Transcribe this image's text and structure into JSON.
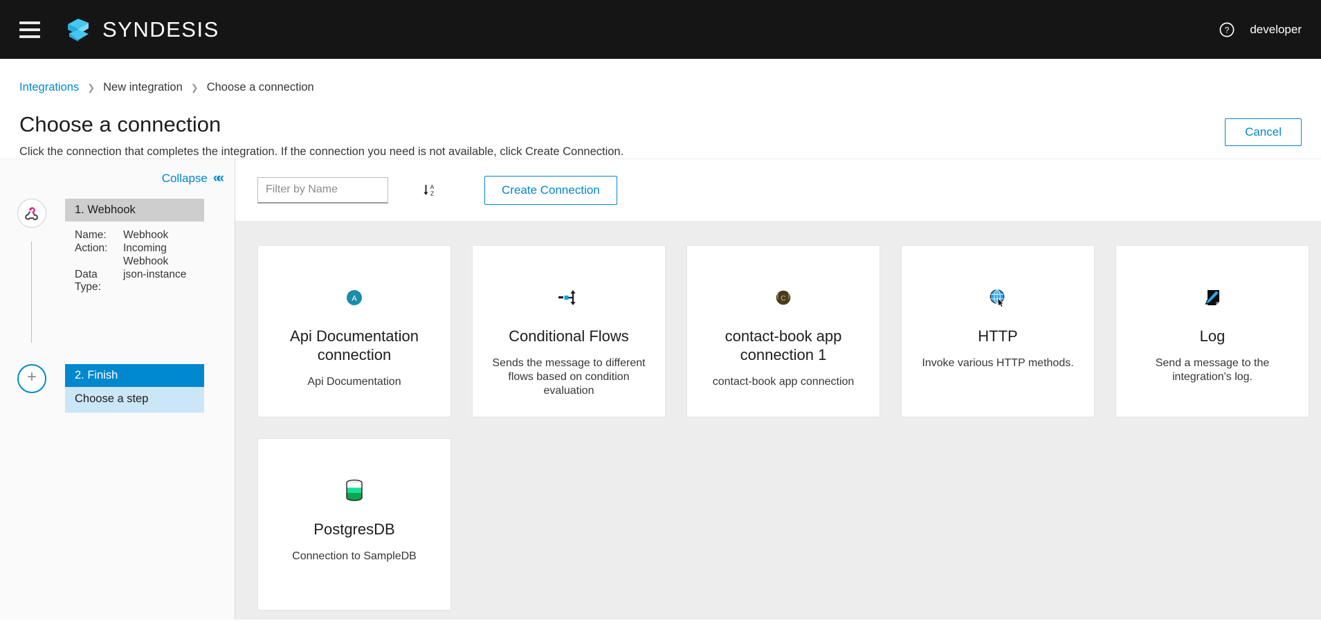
{
  "topbar": {
    "menu_icon": "hamburger-icon",
    "brand": "SYNDESIS",
    "help_icon": "help-circle-icon",
    "username": "developer"
  },
  "breadcrumb": {
    "items": [
      {
        "label": "Integrations",
        "link": true
      },
      {
        "label": "New integration",
        "link": false
      },
      {
        "label": "Choose a connection",
        "link": false
      }
    ],
    "separator": "❯"
  },
  "page": {
    "title": "Choose a connection",
    "description": "Click the connection that completes the integration. If the connection you need is not available, click Create Connection.",
    "cancel_label": "Cancel"
  },
  "sidebar": {
    "collapse_label": "Collapse",
    "collapse_icon": "double-chevron-left-icon",
    "steps": [
      {
        "header": "1. Webhook",
        "icon": "webhook-icon",
        "active": false,
        "details": [
          {
            "key": "Name:",
            "value": "Webhook"
          },
          {
            "key": "Action:",
            "value": "Incoming Webhook"
          },
          {
            "key": "Data Type:",
            "value": "json-instance"
          }
        ]
      },
      {
        "header": "2. Finish",
        "icon": "plus-icon",
        "active": true,
        "sub": "Choose a step"
      }
    ]
  },
  "toolbar": {
    "filter_placeholder": "Filter by Name",
    "filter_value": "",
    "sort_icon": "sort-alpha-down-icon",
    "create_label": "Create Connection"
  },
  "connections": [
    {
      "title": "Api Documentation connection",
      "description": "Api Documentation",
      "icon": "api-documentation-icon",
      "icon_color": "#1b8cab"
    },
    {
      "title": "Conditional Flows",
      "description": "Sends the message to different flows based on condition evaluation",
      "icon": "conditional-flows-icon",
      "icon_color": "#0aa3e8"
    },
    {
      "title": "contact-book app connection 1",
      "description": "contact-book app connection",
      "icon": "contact-book-icon",
      "icon_color": "#4a3b1a"
    },
    {
      "title": "HTTP",
      "description": "Invoke various HTTP methods.",
      "icon": "http-globe-icon",
      "icon_color": "#27a3e8"
    },
    {
      "title": "Log",
      "description": "Send a message to the integration's log.",
      "icon": "log-pen-icon",
      "icon_color": "#29a8e8"
    },
    {
      "title": "PostgresDB",
      "description": "Connection to SampleDB",
      "icon": "database-icon",
      "icon_color": "#16b55f"
    }
  ],
  "colors": {
    "accent": "#0088ce",
    "topbar_bg": "#151515",
    "content_bg": "#ededed",
    "step_active": "#0088ce",
    "step_inactive": "#cecece"
  }
}
